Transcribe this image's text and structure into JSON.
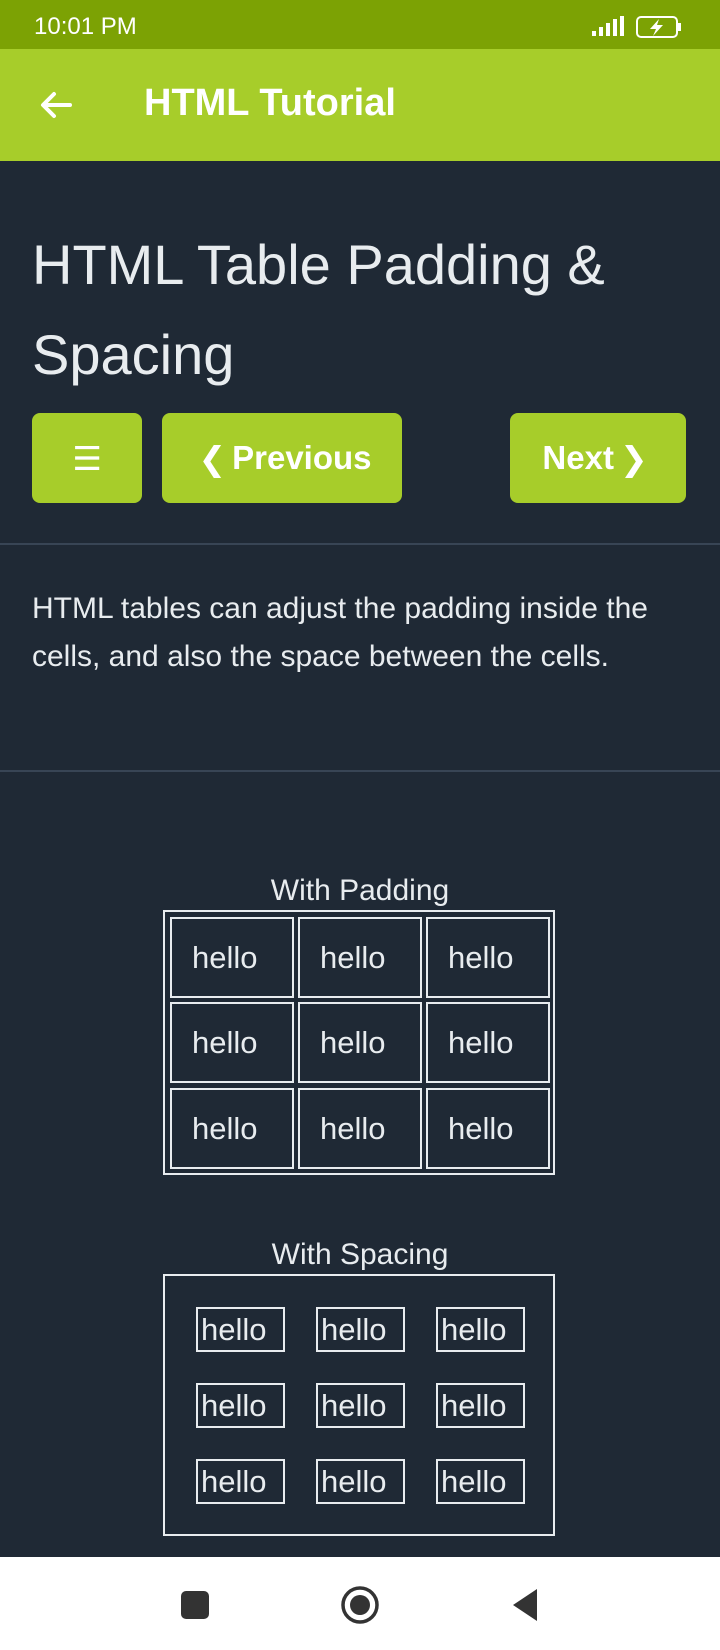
{
  "status_bar": {
    "time": "10:01 PM",
    "icons": [
      "signal-icon",
      "battery-charging-icon"
    ]
  },
  "app_bar": {
    "title": "HTML Tutorial",
    "back_icon": "arrow-left-icon"
  },
  "page": {
    "title": "HTML Table Padding & Spacing",
    "buttons": {
      "menu_glyph": "☰",
      "previous_glyph": "❮",
      "previous_label": "Previous",
      "next_label": "Next",
      "next_glyph": "❯"
    },
    "intro": "HTML tables can adjust the padding inside the cells, and also the space between the cells."
  },
  "examples": [
    {
      "caption": "With Padding",
      "rows": [
        [
          "hello",
          "hello",
          "hello"
        ],
        [
          "hello",
          "hello",
          "hello"
        ],
        [
          "hello",
          "hello",
          "hello"
        ]
      ]
    },
    {
      "caption": "With Spacing",
      "rows": [
        [
          "hello",
          "hello",
          "hello"
        ],
        [
          "hello",
          "hello",
          "hello"
        ],
        [
          "hello",
          "hello",
          "hello"
        ]
      ]
    }
  ],
  "nav_bar": {
    "buttons": [
      "recent-apps-icon",
      "home-icon",
      "back-triangle-icon"
    ]
  },
  "colors": {
    "status_bar": "#7ca204",
    "accent": "#a7cd2a",
    "background": "#1f2935",
    "text": "#e8ecef"
  }
}
